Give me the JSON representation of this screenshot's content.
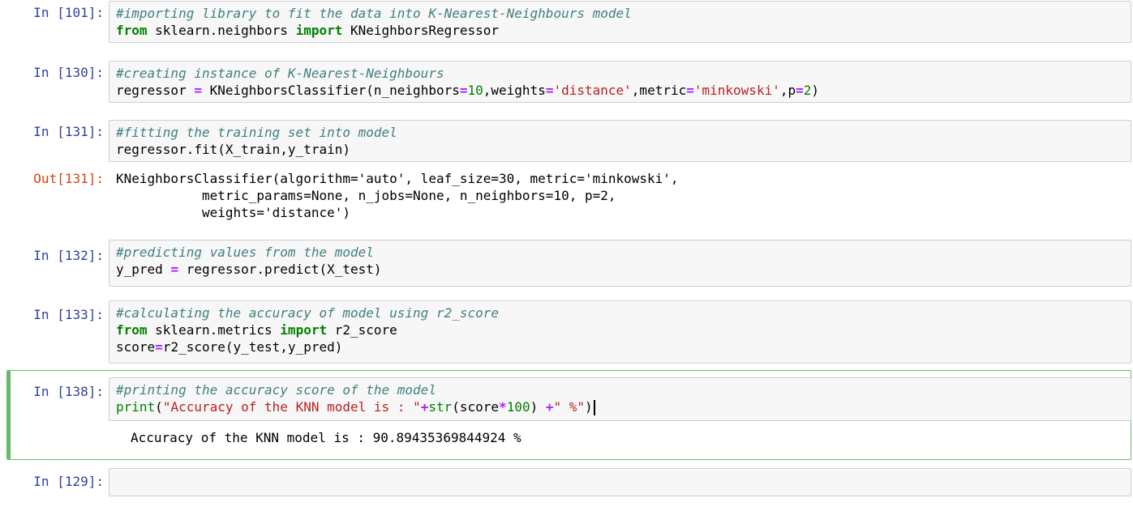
{
  "cells": [
    {
      "prompt": "In [101]:",
      "lines": [
        [
          {
            "t": "#importing library to fit the data into K-Nearest-Neighbours model",
            "c": "c-comment"
          }
        ],
        [
          {
            "t": "from",
            "c": "c-kw"
          },
          {
            "t": " sklearn.neighbors ",
            "c": ""
          },
          {
            "t": "import",
            "c": "c-kw"
          },
          {
            "t": " KNeighborsRegressor",
            "c": ""
          }
        ]
      ]
    },
    {
      "prompt": "In [130]:",
      "lines": [
        [
          {
            "t": "#creating instance of K-Nearest-Neighbours",
            "c": "c-comment"
          }
        ],
        [
          {
            "t": "regressor ",
            "c": ""
          },
          {
            "t": "=",
            "c": "c-op"
          },
          {
            "t": " KNeighborsClassifier(n_neighbors",
            "c": ""
          },
          {
            "t": "=",
            "c": "c-op"
          },
          {
            "t": "10",
            "c": "c-num"
          },
          {
            "t": ",weights",
            "c": ""
          },
          {
            "t": "=",
            "c": "c-op"
          },
          {
            "t": "'distance'",
            "c": "c-str"
          },
          {
            "t": ",metric",
            "c": ""
          },
          {
            "t": "=",
            "c": "c-op"
          },
          {
            "t": "'minkowski'",
            "c": "c-str"
          },
          {
            "t": ",p",
            "c": ""
          },
          {
            "t": "=",
            "c": "c-op"
          },
          {
            "t": "2",
            "c": "c-num"
          },
          {
            "t": ")",
            "c": ""
          }
        ]
      ]
    },
    {
      "prompt": "In [131]:",
      "lines": [
        [
          {
            "t": "#fitting the training set into model",
            "c": "c-comment"
          }
        ],
        [
          {
            "t": "regressor.fit(X_train,y_train)",
            "c": ""
          }
        ]
      ],
      "out_prompt": "Out[131]:",
      "output": [
        "KNeighborsClassifier(algorithm='auto', leaf_size=30, metric='minkowski',",
        "           metric_params=None, n_jobs=None, n_neighbors=10, p=2,",
        "           weights='distance')"
      ]
    },
    {
      "prompt": "In [132]:",
      "lines": [
        [
          {
            "t": "#predicting values from the model",
            "c": "c-comment"
          }
        ],
        [
          {
            "t": "y_pred ",
            "c": ""
          },
          {
            "t": "=",
            "c": "c-op"
          },
          {
            "t": " regressor.predict(X_test)",
            "c": ""
          }
        ]
      ]
    },
    {
      "prompt": "In [133]:",
      "lines": [
        [
          {
            "t": "#calculating the accuracy of model using r2_score",
            "c": "c-comment"
          }
        ],
        [
          {
            "t": "from",
            "c": "c-kw"
          },
          {
            "t": " sklearn.metrics ",
            "c": ""
          },
          {
            "t": "import",
            "c": "c-kw"
          },
          {
            "t": " r2_score",
            "c": ""
          }
        ],
        [
          {
            "t": "score",
            "c": ""
          },
          {
            "t": "=",
            "c": "c-op"
          },
          {
            "t": "r2_score(y_test,y_pred)",
            "c": ""
          }
        ]
      ]
    },
    {
      "prompt": "In [138]:",
      "lines": [
        [
          {
            "t": "#printing the accuracy score of the model",
            "c": "c-comment"
          }
        ],
        [
          {
            "t": "print",
            "c": "c-bi"
          },
          {
            "t": "(",
            "c": ""
          },
          {
            "t": "\"Accuracy of the KNN model is : \"",
            "c": "c-str"
          },
          {
            "t": "+",
            "c": "c-op"
          },
          {
            "t": "str",
            "c": "c-bi"
          },
          {
            "t": "(score",
            "c": ""
          },
          {
            "t": "*",
            "c": "c-op"
          },
          {
            "t": "100",
            "c": "c-num"
          },
          {
            "t": ") ",
            "c": ""
          },
          {
            "t": "+",
            "c": "c-op"
          },
          {
            "t": "\" %\"",
            "c": "c-str"
          },
          {
            "t": ")",
            "c": ""
          }
        ]
      ],
      "stdout": "Accuracy of the KNN model is : 90.89435369844924 %"
    },
    {
      "prompt": "In [129]:",
      "lines": []
    }
  ]
}
